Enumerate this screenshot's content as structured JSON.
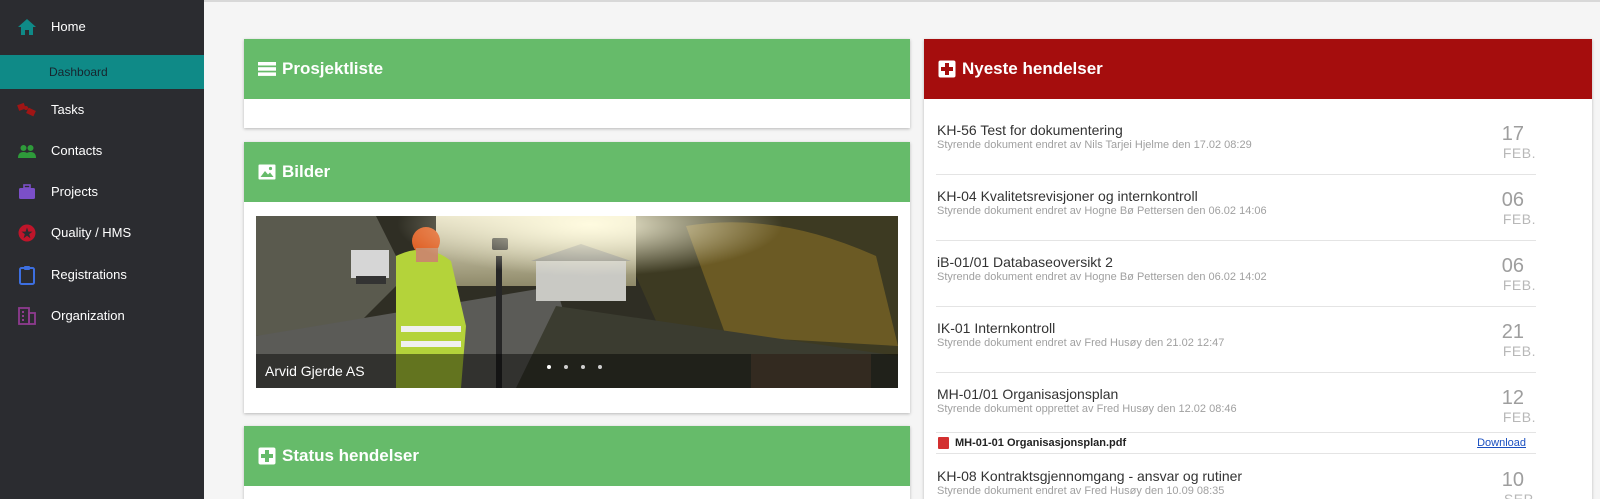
{
  "sidebar": {
    "items": [
      {
        "label": "Home",
        "icon": "home-icon",
        "color": "#0f8a87"
      },
      {
        "label": "Dashboard"
      },
      {
        "label": "Tasks",
        "icon": "tasks-icon",
        "color": "#a01515"
      },
      {
        "label": "Contacts",
        "icon": "contacts-icon",
        "color": "#2e9b3a"
      },
      {
        "label": "Projects",
        "icon": "briefcase-icon",
        "color": "#7b4fc8"
      },
      {
        "label": "Quality / HMS",
        "icon": "quality-icon",
        "color": "#c0152a"
      },
      {
        "label": "Registrations",
        "icon": "clipboard-icon",
        "color": "#3d6fe0"
      },
      {
        "label": "Organization",
        "icon": "organization-icon",
        "color": "#8e3b8f"
      }
    ]
  },
  "panels": {
    "project_list": {
      "title": "Prosjektliste"
    },
    "images": {
      "title": "Bilder",
      "caption": "Arvid Gjerde AS",
      "slide_count": 4,
      "active_slide": 1
    },
    "status_events": {
      "title": "Status hendelser"
    },
    "latest_events": {
      "title": "Nyeste hendelser"
    }
  },
  "events": [
    {
      "title": "KH-56 Test for dokumentering",
      "subtitle": "Styrende dokument endret av Nils Tarjei Hjelme den 17.02 08:29",
      "day": "17",
      "month": "FEB."
    },
    {
      "title": "KH-04 Kvalitetsrevisjoner og internkontroll",
      "subtitle": "Styrende dokument endret av Hogne Bø Pettersen den 06.02 14:06",
      "day": "06",
      "month": "FEB."
    },
    {
      "title": "iB-01/01 Databaseoversikt 2",
      "subtitle": "Styrende dokument endret av Hogne Bø Pettersen den 06.02 14:02",
      "day": "06",
      "month": "FEB."
    },
    {
      "title": "IK-01 Internkontroll",
      "subtitle": "Styrende dokument endret av Fred Husøy den 21.02 12:47",
      "day": "21",
      "month": "FEB."
    },
    {
      "title": "MH-01/01 Organisasjonsplan",
      "subtitle": "Styrende dokument opprettet av Fred Husøy den 12.02 08:46",
      "day": "12",
      "month": "FEB."
    },
    {
      "title": "KH-08 Kontraktsgjennomgang - ansvar og rutiner",
      "subtitle": "Styrende dokument endret av Fred Husøy den 10.09 08:35",
      "day": "10",
      "month": "SEP."
    }
  ],
  "attachment": {
    "name": "MH-01-01 Organisasjonsplan.pdf",
    "action": "Download",
    "icon": "pdf-icon"
  },
  "colors": {
    "sidebar": "#2b2c30",
    "active_nav": "#0f8a87",
    "green_header": "#66bb6a",
    "red_header": "#a50d0d"
  }
}
